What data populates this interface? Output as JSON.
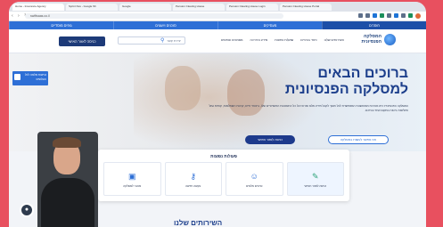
{
  "browser": {
    "tabs": [
      "Home - Insurance Agency",
      "Sprint Dev - Google Sh",
      "Google",
      "Pension Clearing House",
      "Pension Clearing House Login",
      "Pension Clearing House Portal"
    ],
    "url": "swiftsaas.co.il"
  },
  "site": {
    "categories": [
      "חוסכים",
      "מעסיקים",
      "סוכנים ויועצים",
      "גופים מוסדיים"
    ],
    "logo_line1": "המסלקה",
    "logo_line2": "הפנסיונית",
    "menu": [
      "השירותים שלנו",
      "כיצד בוחרים",
      "שאלות נפוצות",
      "מידע והדרכה",
      "מסמכים וטפסים"
    ],
    "search_placeholder": "יצירת קשר",
    "login_label": "כניסה לאזור האישי",
    "hero_title_1": "ברוכים הבאים",
    "hero_title_2": "למסלקה הפנסיונית",
    "hero_text": "המסלקה הפנסיונית היא מערכת ממוחשבת המאפשרת לכל חוסך לקבל מידע מלא ומרוכז על כל החסכונות הפנסיוניים שלו, ביטוחי חיים, קרנות השתלמות, קופות גמל ופוליסות ביטוח במקום אחד ובחינם.",
    "hero_button_primary": "כניסה לאזור האישי",
    "hero_button_secondary": "מה אפשר לעשות במסלקה",
    "side_badge": "נגישות מלאה לכל הגולשים",
    "quick_title": "פעולות נפוצות",
    "quick_actions": [
      {
        "label": "כניסה לאזור האישי",
        "icon": "document-check-icon"
      },
      {
        "label": "פרטים מלאים",
        "icon": "person-icon"
      },
      {
        "label": "בקשה חדשה",
        "icon": "key-icon"
      },
      {
        "label": "מעבר למסלקה",
        "icon": "briefcase-icon"
      }
    ],
    "section_title": "השירותים שלנו"
  }
}
